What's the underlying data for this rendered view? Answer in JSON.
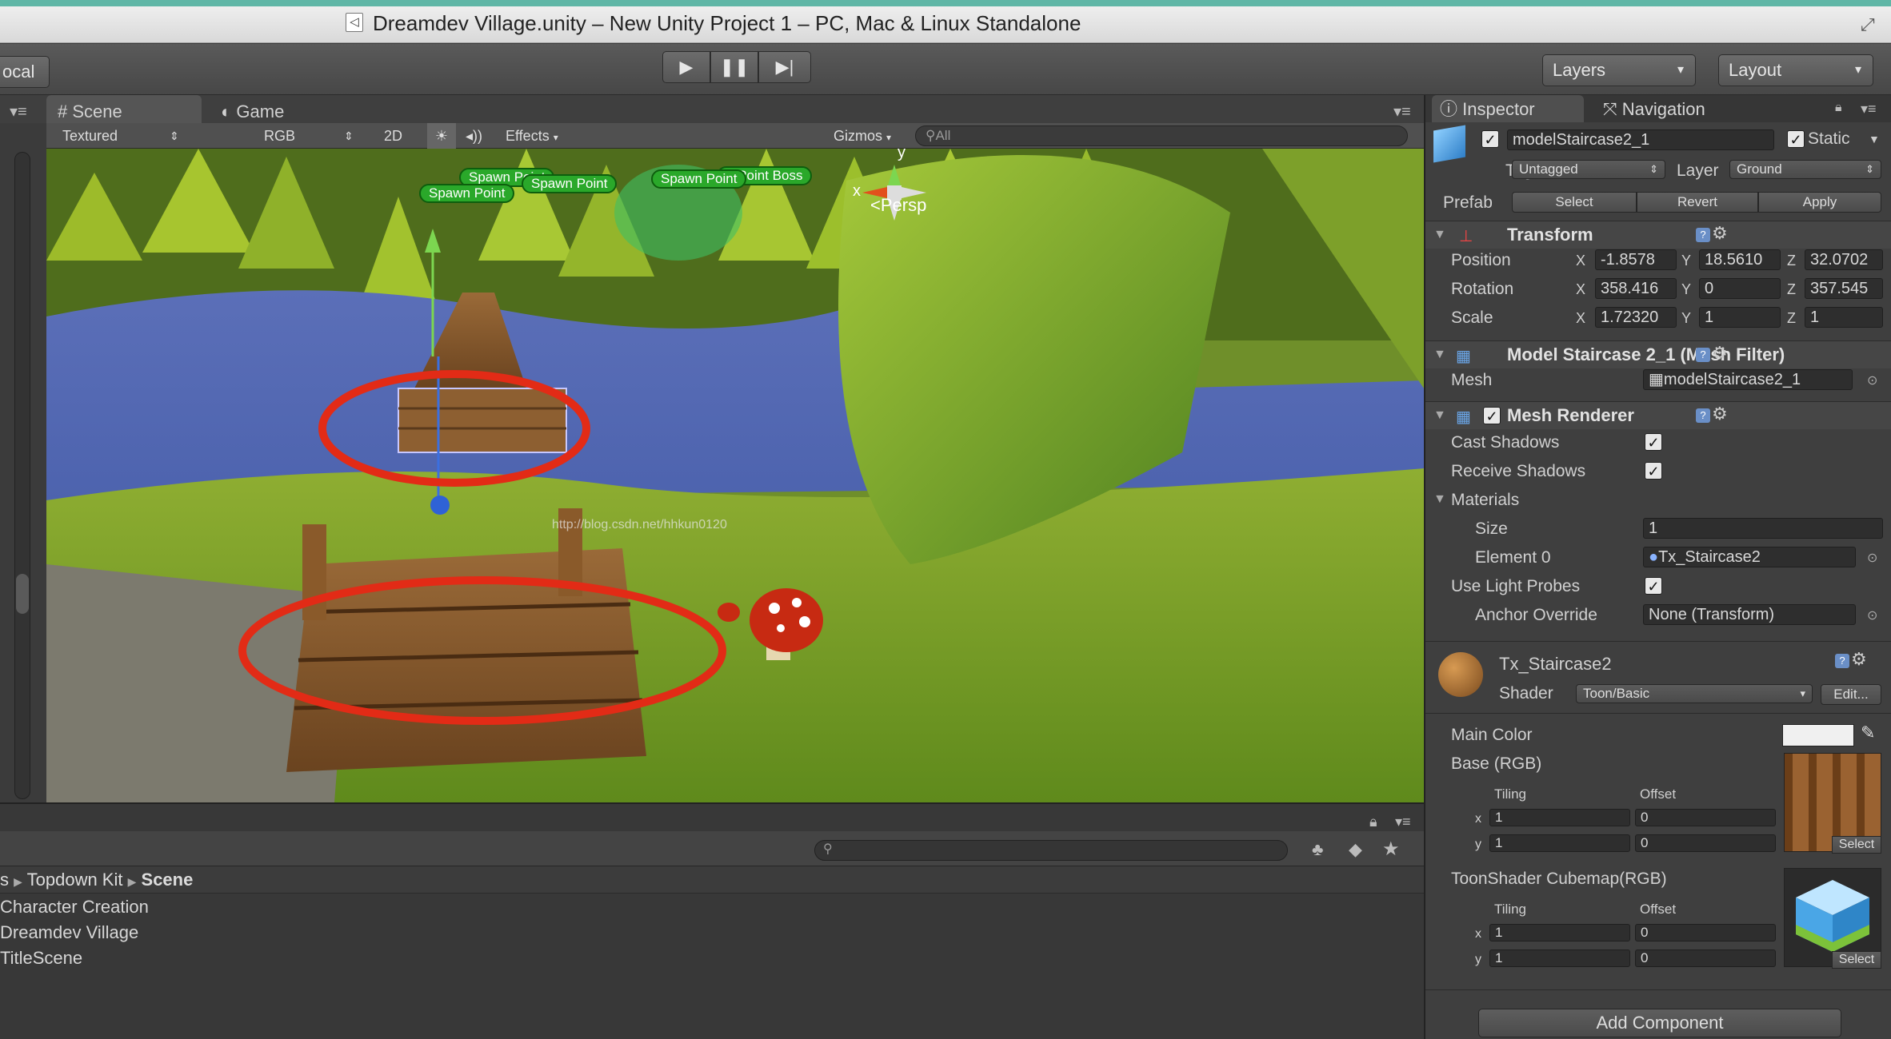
{
  "window": {
    "title": "Dreamdev Village.unity – New Unity Project 1 – PC, Mac & Linux Standalone"
  },
  "toolbar": {
    "local_label": "ocal",
    "layers_label": "Layers",
    "layout_label": "Layout"
  },
  "scene_panel": {
    "tabs": [
      "Scene",
      "Game"
    ],
    "shading_mode": "Textured",
    "render_mode": "RGB",
    "toggle_2d": "2D",
    "effects_label": "Effects",
    "gizmos_label": "Gizmos",
    "search_placeholder": "All"
  },
  "viewport": {
    "labels": [
      "Spawn Point",
      "Spawn Point",
      "Spawn Point",
      "Spawn Point",
      "n Point Boss"
    ],
    "persp_label": "Persp",
    "axis_x": "x",
    "axis_y": "y",
    "watermark": "http://blog.csdn.net/hhkun0120"
  },
  "project": {
    "breadcrumb": [
      "s",
      "Topdown Kit",
      "Scene"
    ],
    "scenes": [
      "Character Creation",
      "Dreamdev Village",
      "TitleScene"
    ]
  },
  "inspector": {
    "tabs": [
      "Inspector",
      "Navigation"
    ],
    "object_name": "modelStaircase2_1",
    "static_label": "Static",
    "tag_label": "Tag",
    "tag_value": "Untagged",
    "layer_label": "Layer",
    "layer_value": "Ground",
    "prefab_label": "Prefab",
    "prefab_buttons": [
      "Select",
      "Revert",
      "Apply"
    ],
    "transform": {
      "title": "Transform",
      "position": {
        "label": "Position",
        "x": "-1.8578",
        "y": "18.5610",
        "z": "32.0702"
      },
      "rotation": {
        "label": "Rotation",
        "x": "358.416",
        "y": "0",
        "z": "357.545"
      },
      "scale": {
        "label": "Scale",
        "x": "1.72320",
        "y": "1",
        "z": "1"
      },
      "axis_x": "X",
      "axis_y": "Y",
      "axis_z": "Z"
    },
    "mesh_filter": {
      "title": "Model Staircase 2_1 (Mesh Filter)",
      "mesh_label": "Mesh",
      "mesh_value": "modelStaircase2_1"
    },
    "mesh_renderer": {
      "title": "Mesh Renderer",
      "cast_shadows": "Cast Shadows",
      "receive_shadows": "Receive Shadows",
      "materials": "Materials",
      "size_label": "Size",
      "size_value": "1",
      "element0_label": "Element 0",
      "element0_value": "Tx_Staircase2",
      "light_probes": "Use Light Probes",
      "anchor_label": "Anchor Override",
      "anchor_value": "None (Transform)"
    },
    "material": {
      "name": "Tx_Staircase2",
      "shader_label": "Shader",
      "shader_value": "Toon/Basic",
      "edit_label": "Edit...",
      "main_color": "Main Color",
      "base_rgb": "Base (RGB)",
      "cubemap": "ToonShader Cubemap(RGB)",
      "tiling": "Tiling",
      "offset": "Offset",
      "x": "x",
      "y": "y",
      "tiling_x": "1",
      "tiling_y": "1",
      "offset_x": "0",
      "offset_y": "0",
      "select": "Select"
    },
    "add_component": "Add Component"
  }
}
